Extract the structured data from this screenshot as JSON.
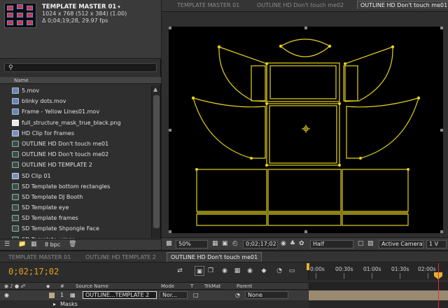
{
  "project": {
    "comp_name": "TEMPLATE MASTER 01",
    "comp_caret": "▾",
    "dimensions": "1024 x 768  (512 x 384) (1.00)",
    "duration": "Δ 0;04;19;28, 29.97 fps",
    "search": {
      "value": "",
      "placeholder": ""
    },
    "column_header": "Name",
    "items": [
      {
        "label": "5.mov",
        "type": "mov"
      },
      {
        "label": "blinky dots.mov",
        "type": "mov"
      },
      {
        "label": "Frame - Yellow Lines01.mov",
        "type": "mov"
      },
      {
        "label": "full_structure_mask_true_black.png",
        "type": "png"
      },
      {
        "label": "HD Clip for Frames",
        "type": "clip"
      },
      {
        "label": "OUTLINE HD Don't touch me01",
        "type": "comp"
      },
      {
        "label": "OUTLINE HD Don't touch me02",
        "type": "comp"
      },
      {
        "label": "OUTLINE HD TEMPLATE 2",
        "type": "comp"
      },
      {
        "label": "SD Clip 01",
        "type": "clip"
      },
      {
        "label": "SD Template bottom rectangles",
        "type": "comp"
      },
      {
        "label": "SD Template DJ Booth",
        "type": "comp"
      },
      {
        "label": "SD Template eye",
        "type": "comp"
      },
      {
        "label": "SD Template frames",
        "type": "comp"
      },
      {
        "label": "SD Template Shpongle Face",
        "type": "comp"
      },
      {
        "label": "SD Template wings",
        "type": "comp"
      }
    ],
    "bit_depth": "8 bpc"
  },
  "viewer": {
    "tabs": [
      {
        "label": "TEMPLATE MASTER 01",
        "active": false
      },
      {
        "label": "OUTLINE HD Don't touch me02",
        "active": false
      },
      {
        "label": "OUTLINE HD Don't touch me01",
        "active": true
      }
    ],
    "zoom": "50%",
    "timecode": "0;02;17;02",
    "resolution": "Half",
    "camera": "Active Camera",
    "views": "1 V",
    "outline_color": "#e6d21e",
    "canvas_color": "#000000"
  },
  "timeline": {
    "tabs": [
      {
        "label": "TEMPLATE MASTER 01",
        "active": false
      },
      {
        "label": "OUTLINE HD TEMPLATE 2",
        "active": false
      },
      {
        "label": "OUTLINE HD Don't touch me01",
        "active": true
      }
    ],
    "current_time": "0;02;17;02",
    "ruler_labels": [
      "0:00s",
      "00:30s",
      "01:00s",
      "01:30s",
      "02:00s"
    ],
    "columns": {
      "source_name": "Source Name",
      "mode": "Mode",
      "t": "T",
      "trkmat": "TrkMat",
      "parent": "Parent"
    },
    "layer": {
      "index": "1",
      "name": "OUTLINE...TEMPLATE 2",
      "mode": "Nor...",
      "parent": "None"
    },
    "sub_property": "Masks",
    "playhead_color": "#e03030",
    "timecode_color": "#e8a020"
  }
}
